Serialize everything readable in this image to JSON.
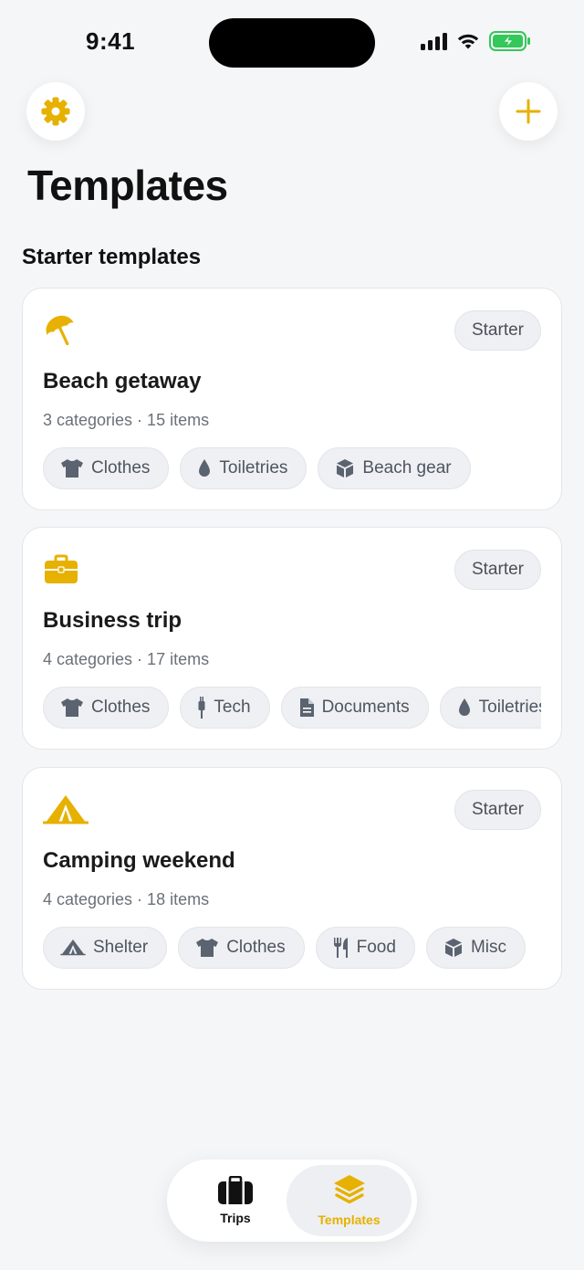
{
  "status_bar": {
    "time": "9:41"
  },
  "header": {
    "title": "Templates"
  },
  "section": {
    "title": "Starter templates"
  },
  "colors": {
    "accent": "#e6b100",
    "chip_bg": "#eef0f3",
    "battery": "#34c759"
  },
  "templates": [
    {
      "icon": "umbrella-icon",
      "badge": "Starter",
      "title": "Beach getaway",
      "meta": "3 categories · 15 items",
      "chips": [
        {
          "icon": "tshirt-icon",
          "label": "Clothes"
        },
        {
          "icon": "droplet-icon",
          "label": "Toiletries"
        },
        {
          "icon": "box-icon",
          "label": "Beach gear"
        }
      ]
    },
    {
      "icon": "briefcase-icon",
      "badge": "Starter",
      "title": "Business trip",
      "meta": "4 categories · 17 items",
      "chips": [
        {
          "icon": "tshirt-icon",
          "label": "Clothes"
        },
        {
          "icon": "plug-icon",
          "label": "Tech"
        },
        {
          "icon": "document-icon",
          "label": "Documents"
        },
        {
          "icon": "droplet-icon",
          "label": "Toiletries"
        }
      ]
    },
    {
      "icon": "tent-icon",
      "badge": "Starter",
      "title": "Camping weekend",
      "meta": "4 categories · 18 items",
      "chips": [
        {
          "icon": "tent-icon",
          "label": "Shelter"
        },
        {
          "icon": "tshirt-icon",
          "label": "Clothes"
        },
        {
          "icon": "utensils-icon",
          "label": "Food"
        },
        {
          "icon": "box-icon",
          "label": "Misc"
        }
      ]
    }
  ],
  "tab_bar": {
    "tabs": [
      {
        "label": "Trips",
        "icon": "suitcase-icon",
        "active": false
      },
      {
        "label": "Templates",
        "icon": "layers-icon",
        "active": true
      }
    ]
  }
}
